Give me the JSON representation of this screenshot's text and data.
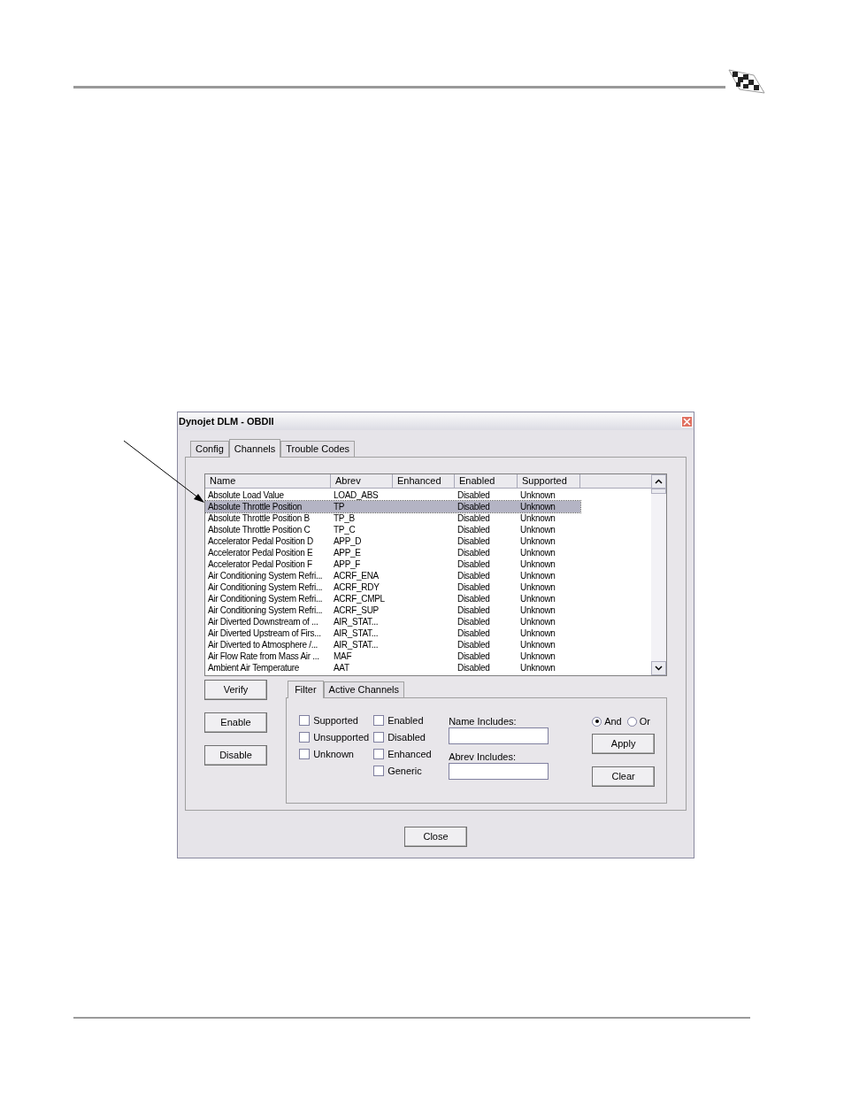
{
  "window": {
    "title": "Dynojet DLM - OBDII"
  },
  "tabs": [
    {
      "label": "Config",
      "selected": false
    },
    {
      "label": "Channels",
      "selected": true
    },
    {
      "label": "Trouble Codes",
      "selected": false
    }
  ],
  "table": {
    "columns": [
      "Name",
      "Abrev",
      "Enhanced",
      "Enabled",
      "Supported"
    ],
    "rows": [
      {
        "cells": [
          "Absolute Load Value",
          "LOAD_ABS",
          "",
          "Disabled",
          "Unknown"
        ],
        "selected": false
      },
      {
        "cells": [
          "Absolute Throttle Position",
          "TP",
          "",
          "Disabled",
          "Unknown"
        ],
        "selected": true
      },
      {
        "cells": [
          "Absolute Throttle Position B",
          "TP_B",
          "",
          "Disabled",
          "Unknown"
        ],
        "selected": false
      },
      {
        "cells": [
          "Absolute Throttle Position C",
          "TP_C",
          "",
          "Disabled",
          "Unknown"
        ],
        "selected": false
      },
      {
        "cells": [
          "Accelerator Pedal Position D",
          "APP_D",
          "",
          "Disabled",
          "Unknown"
        ],
        "selected": false
      },
      {
        "cells": [
          "Accelerator Pedal Position E",
          "APP_E",
          "",
          "Disabled",
          "Unknown"
        ],
        "selected": false
      },
      {
        "cells": [
          "Accelerator Pedal Position F",
          "APP_F",
          "",
          "Disabled",
          "Unknown"
        ],
        "selected": false
      },
      {
        "cells": [
          "Air Conditioning System Refri...",
          "ACRF_ENA",
          "",
          "Disabled",
          "Unknown"
        ],
        "selected": false
      },
      {
        "cells": [
          "Air Conditioning System Refri...",
          "ACRF_RDY",
          "",
          "Disabled",
          "Unknown"
        ],
        "selected": false
      },
      {
        "cells": [
          "Air Conditioning System Refri...",
          "ACRF_CMPL",
          "",
          "Disabled",
          "Unknown"
        ],
        "selected": false
      },
      {
        "cells": [
          "Air Conditioning System Refri...",
          "ACRF_SUP",
          "",
          "Disabled",
          "Unknown"
        ],
        "selected": false
      },
      {
        "cells": [
          "Air Diverted Downstream of ...",
          "AIR_STAT...",
          "",
          "Disabled",
          "Unknown"
        ],
        "selected": false
      },
      {
        "cells": [
          "Air Diverted Upstream of Firs...",
          "AIR_STAT...",
          "",
          "Disabled",
          "Unknown"
        ],
        "selected": false
      },
      {
        "cells": [
          "Air Diverted to Atmosphere /...",
          "AIR_STAT...",
          "",
          "Disabled",
          "Unknown"
        ],
        "selected": false
      },
      {
        "cells": [
          "Air Flow Rate from Mass Air ...",
          "MAF",
          "",
          "Disabled",
          "Unknown"
        ],
        "selected": false
      },
      {
        "cells": [
          "Ambient Air Temperature",
          "AAT",
          "",
          "Disabled",
          "Unknown"
        ],
        "selected": false
      }
    ]
  },
  "side_buttons": [
    "Verify",
    "Enable",
    "Disable"
  ],
  "filter_tabs": [
    {
      "label": "Filter",
      "selected": true
    },
    {
      "label": "Active Channels",
      "selected": false
    }
  ],
  "checkbox_columns": [
    [
      {
        "label": "Supported",
        "checked": false
      },
      {
        "label": "Unsupported",
        "checked": false
      },
      {
        "label": "Unknown",
        "checked": false
      }
    ],
    [
      {
        "label": "Enabled",
        "checked": false
      },
      {
        "label": "Disabled",
        "checked": false
      },
      {
        "label": "Enhanced",
        "checked": false
      },
      {
        "label": "Generic",
        "checked": false
      }
    ]
  ],
  "fields": [
    {
      "label": "Name Includes:"
    },
    {
      "label": "Abrev Includes:"
    }
  ],
  "radios": [
    {
      "label": "And",
      "selected": true
    },
    {
      "label": "Or",
      "selected": false
    }
  ],
  "filter_buttons": [
    "Apply",
    "Clear"
  ],
  "close_button": "Close"
}
